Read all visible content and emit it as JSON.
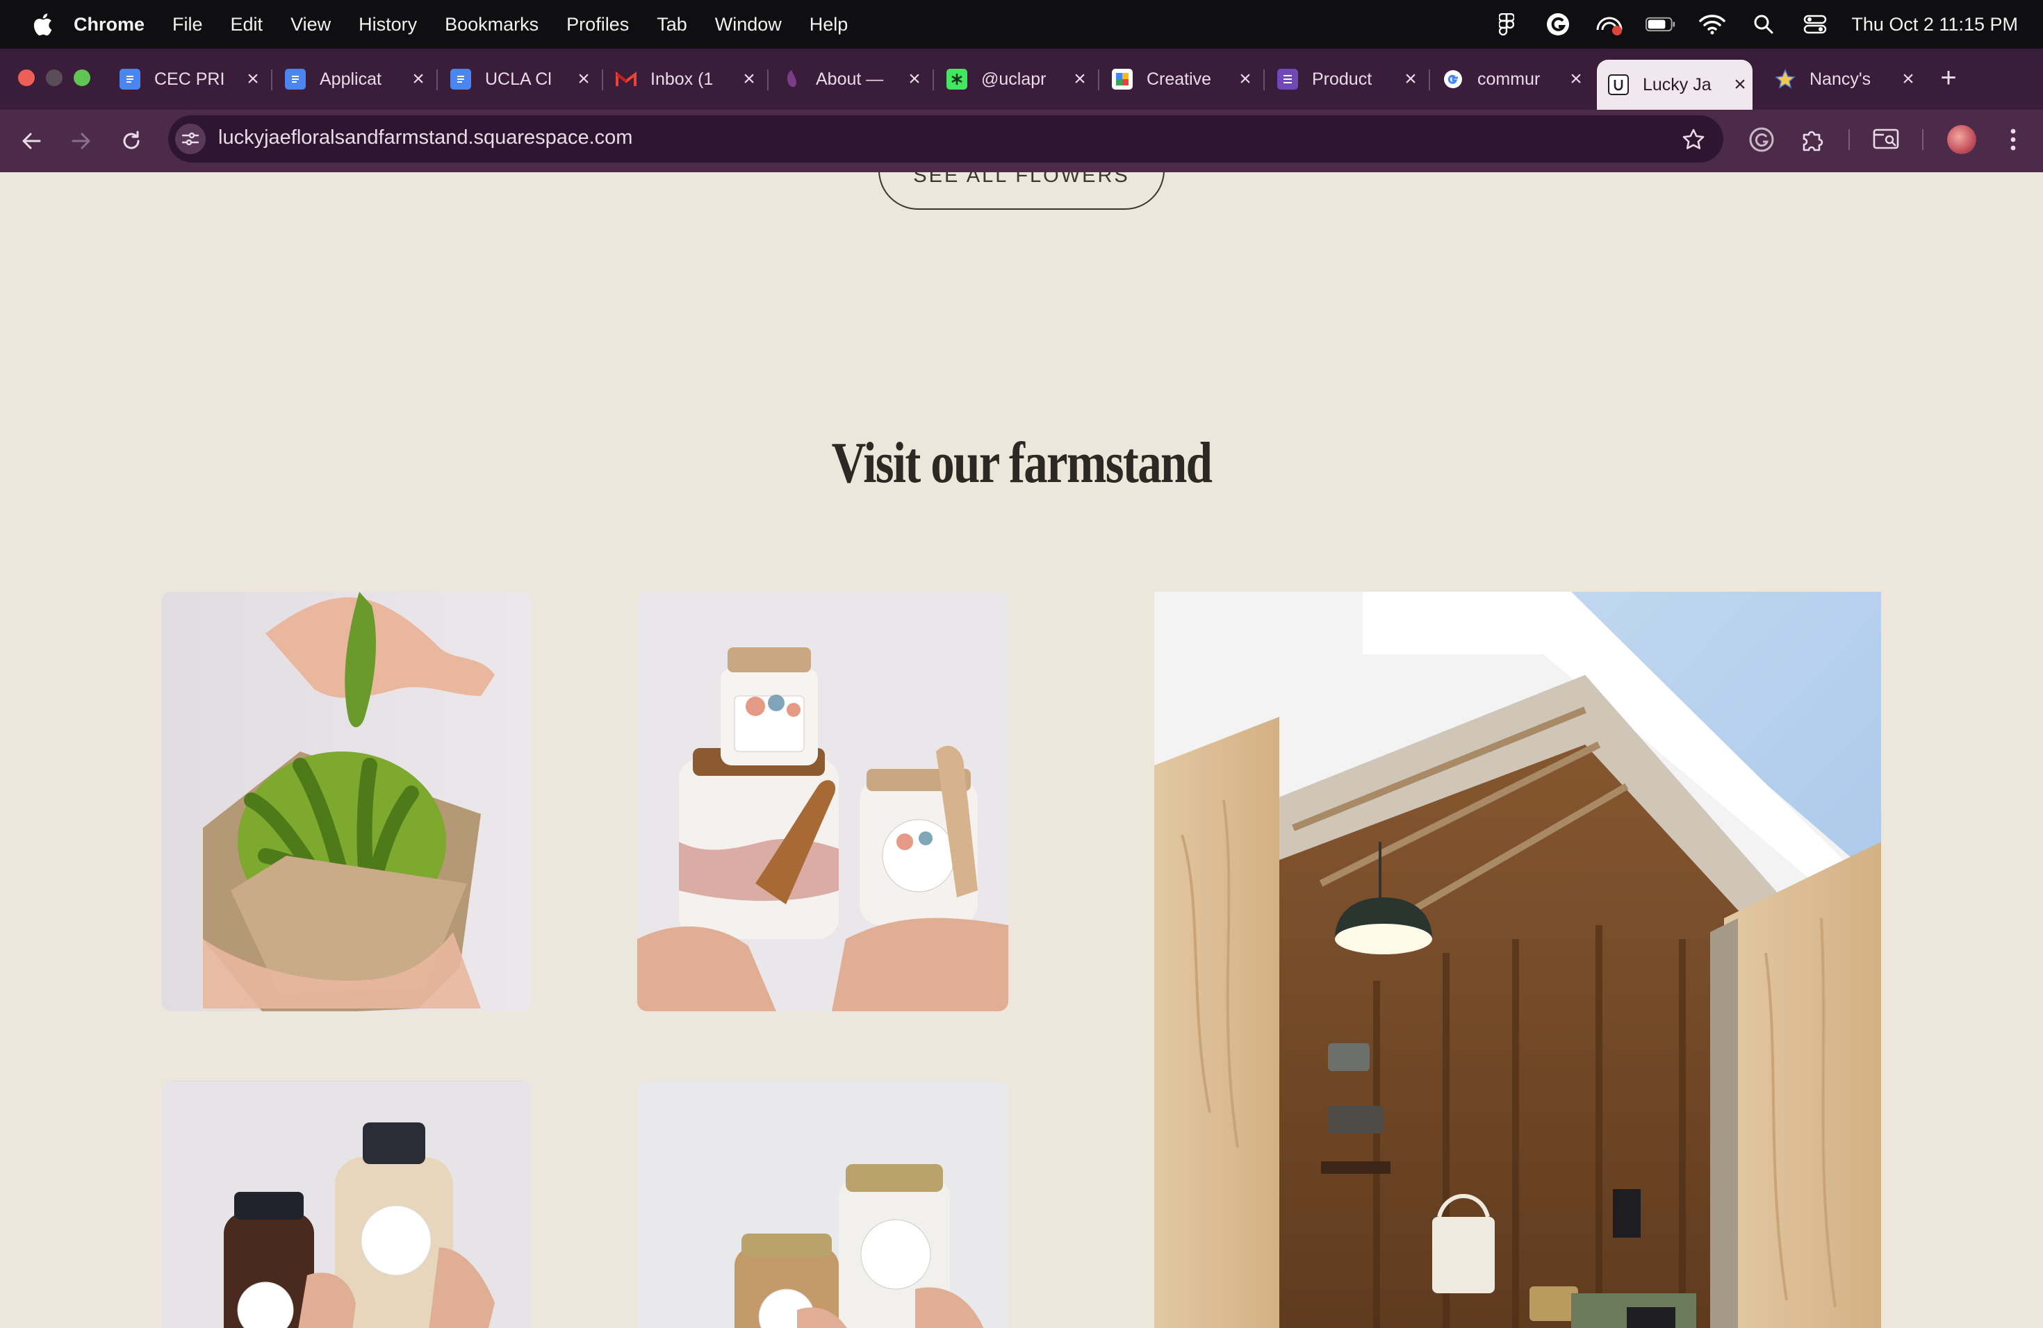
{
  "menubar": {
    "app_name": "Chrome",
    "items": [
      "File",
      "Edit",
      "View",
      "History",
      "Bookmarks",
      "Profiles",
      "Tab",
      "Window",
      "Help"
    ],
    "clock": "Thu Oct 2  11:15 PM"
  },
  "tabs": [
    {
      "label": "CEC PRI",
      "icon": "google-docs-icon"
    },
    {
      "label": "Applicat",
      "icon": "google-docs-icon"
    },
    {
      "label": "UCLA Cl",
      "icon": "google-docs-icon"
    },
    {
      "label": "Inbox (1",
      "icon": "gmail-icon"
    },
    {
      "label": "About —",
      "icon": "site-icon"
    },
    {
      "label": "@uclapr",
      "icon": "linktree-icon"
    },
    {
      "label": "Creative",
      "icon": "google-slides-icon"
    },
    {
      "label": "Product",
      "icon": "forms-icon"
    },
    {
      "label": "commur",
      "icon": "google-icon"
    },
    {
      "label": "Lucky Ja",
      "icon": "squarespace-icon",
      "active": true
    },
    {
      "label": "Nancy's",
      "icon": "star-favicon"
    }
  ],
  "address_bar": {
    "url": "luckyjaefloralsandfarmstand.squarespace.com"
  },
  "page": {
    "see_all_button": "SEE ALL FLOWERS",
    "section_title": "Visit our farmstand"
  },
  "colors": {
    "page_background": "#ede6da",
    "tab_strip": "#3a1d3a",
    "toolbar": "#4c2b4a",
    "title_text": "#2c2824"
  }
}
